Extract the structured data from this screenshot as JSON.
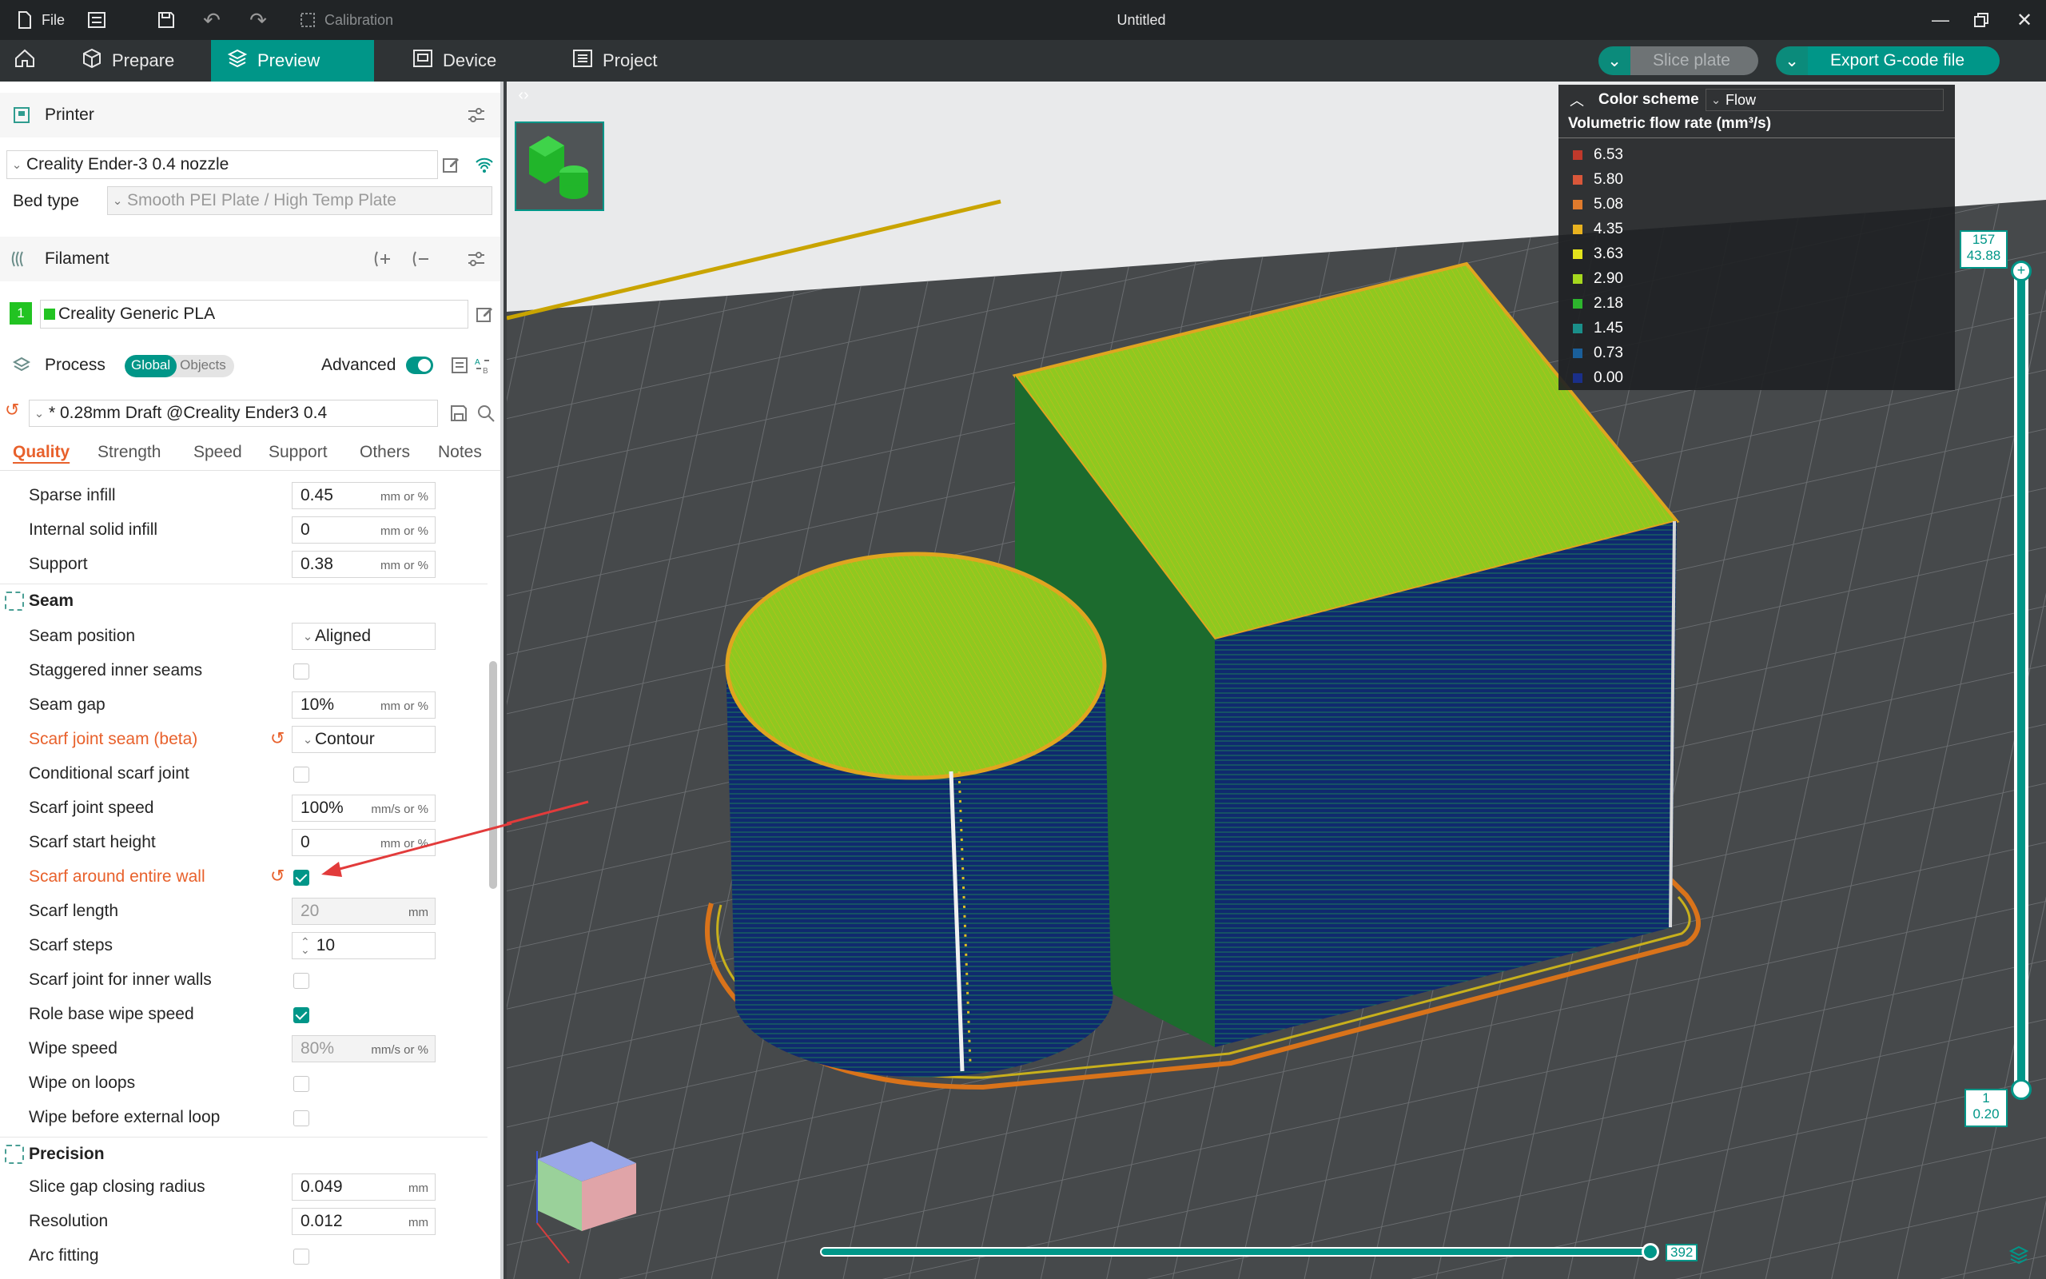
{
  "titlebar": {
    "file_label": "File",
    "calibration_label": "Calibration",
    "window_title": "Untitled"
  },
  "nav": {
    "prepare": "Prepare",
    "preview": "Preview",
    "device": "Device",
    "project": "Project",
    "slice_plate": "Slice plate",
    "export_gcode": "Export G-code file"
  },
  "printer": {
    "section_label": "Printer",
    "printer_name": "Creality Ender-3 0.4 nozzle",
    "bed_type_label": "Bed type",
    "bed_type_value": "Smooth PEI Plate / High Temp Plate"
  },
  "filament": {
    "section_label": "Filament",
    "slot_number": "1",
    "filament_name": "Creality Generic PLA",
    "swatch_color": "#22c322"
  },
  "process": {
    "section_label": "Process",
    "global_label": "Global",
    "objects_label": "Objects",
    "advanced_label": "Advanced",
    "advanced_on": true,
    "preset_name": "* 0.28mm Draft @Creality Ender3 0.4",
    "tabs": [
      "Quality",
      "Strength",
      "Speed",
      "Support",
      "Others",
      "Notes"
    ],
    "active_tab": "Quality"
  },
  "settings": {
    "sparse_infill": {
      "label": "Sparse infill",
      "value": "0.45",
      "unit": "mm or %"
    },
    "internal_solid_infill": {
      "label": "Internal solid infill",
      "value": "0",
      "unit": "mm or %"
    },
    "support": {
      "label": "Support",
      "value": "0.38",
      "unit": "mm or %"
    },
    "seam_group": "Seam",
    "seam_position": {
      "label": "Seam position",
      "value": "Aligned"
    },
    "staggered_inner_seams": {
      "label": "Staggered inner seams",
      "checked": false
    },
    "seam_gap": {
      "label": "Seam gap",
      "value": "10%",
      "unit": "mm or %"
    },
    "scarf_joint_seam": {
      "label": "Scarf joint seam (beta)",
      "value": "Contour"
    },
    "conditional_scarf_joint": {
      "label": "Conditional scarf joint",
      "checked": false
    },
    "scarf_joint_speed": {
      "label": "Scarf joint speed",
      "value": "100%",
      "unit": "mm/s or %"
    },
    "scarf_start_height": {
      "label": "Scarf start height",
      "value": "0",
      "unit": "mm or %"
    },
    "scarf_around_entire_wall": {
      "label": "Scarf around entire wall",
      "checked": true
    },
    "scarf_length": {
      "label": "Scarf length",
      "value": "20",
      "unit": "mm"
    },
    "scarf_steps": {
      "label": "Scarf steps",
      "value": "10"
    },
    "scarf_joint_inner_walls": {
      "label": "Scarf joint for inner walls",
      "checked": false
    },
    "role_base_wipe_speed": {
      "label": "Role base wipe speed",
      "checked": true
    },
    "wipe_speed": {
      "label": "Wipe speed",
      "value": "80%",
      "unit": "mm/s or %"
    },
    "wipe_on_loops": {
      "label": "Wipe on loops",
      "checked": false
    },
    "wipe_before_external_loop": {
      "label": "Wipe before external loop",
      "checked": false
    },
    "precision_group": "Precision",
    "slice_gap_closing_radius": {
      "label": "Slice gap closing radius",
      "value": "0.049",
      "unit": "mm"
    },
    "resolution": {
      "label": "Resolution",
      "value": "0.012",
      "unit": "mm"
    },
    "arc_fitting": {
      "label": "Arc fitting",
      "checked": false
    }
  },
  "legend": {
    "color_scheme_label": "Color scheme",
    "scheme_value": "Flow",
    "title": "Volumetric flow rate (mm³/s)",
    "entries": [
      {
        "value": "6.53",
        "color": "#c0392b"
      },
      {
        "value": "5.80",
        "color": "#d9573a"
      },
      {
        "value": "5.08",
        "color": "#e07b2c"
      },
      {
        "value": "4.35",
        "color": "#e8b21f"
      },
      {
        "value": "3.63",
        "color": "#e3e31c"
      },
      {
        "value": "2.90",
        "color": "#a6d81e"
      },
      {
        "value": "2.18",
        "color": "#2db52d"
      },
      {
        "value": "1.45",
        "color": "#1a8f8a"
      },
      {
        "value": "0.73",
        "color": "#1a5f9a"
      },
      {
        "value": "0.00",
        "color": "#1a2f8a"
      }
    ]
  },
  "layer_slider": {
    "top_layer": "157",
    "top_height": "43.88",
    "bottom_layer": "1",
    "bottom_height": "0.20",
    "move_value": "392"
  },
  "colors": {
    "accent": "#009688",
    "modified": "#e8612c"
  }
}
